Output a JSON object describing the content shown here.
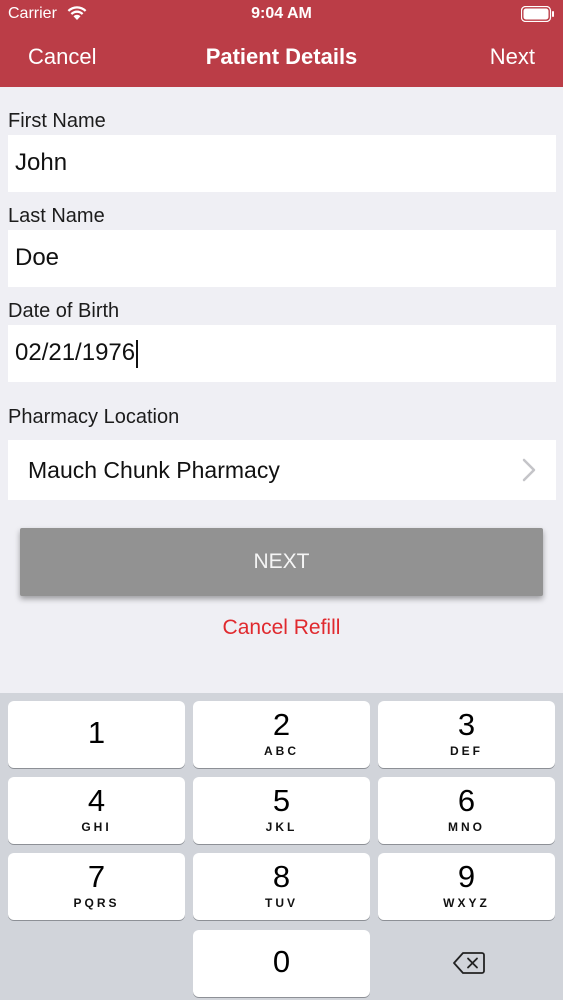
{
  "status_bar": {
    "carrier": "Carrier",
    "time": "9:04 AM"
  },
  "nav": {
    "cancel": "Cancel",
    "title": "Patient Details",
    "next": "Next"
  },
  "form": {
    "first_name": {
      "label": "First Name",
      "value": "John"
    },
    "last_name": {
      "label": "Last Name",
      "value": "Doe"
    },
    "dob": {
      "label": "Date of Birth",
      "value": "02/21/1976"
    },
    "pharmacy": {
      "label": "Pharmacy Location",
      "value": "Mauch Chunk Pharmacy"
    }
  },
  "actions": {
    "next": "NEXT",
    "cancel_refill": "Cancel Refill"
  },
  "keypad": {
    "keys": [
      {
        "digit": "1",
        "letters": ""
      },
      {
        "digit": "2",
        "letters": "ABC"
      },
      {
        "digit": "3",
        "letters": "DEF"
      },
      {
        "digit": "4",
        "letters": "GHI"
      },
      {
        "digit": "5",
        "letters": "JKL"
      },
      {
        "digit": "6",
        "letters": "MNO"
      },
      {
        "digit": "7",
        "letters": "PQRS"
      },
      {
        "digit": "8",
        "letters": "TUV"
      },
      {
        "digit": "9",
        "letters": "WXYZ"
      },
      {
        "digit": "0",
        "letters": ""
      }
    ]
  },
  "colors": {
    "header": "#bb3d47",
    "cancel_refill": "#e0292e",
    "next_button": "#929292"
  }
}
